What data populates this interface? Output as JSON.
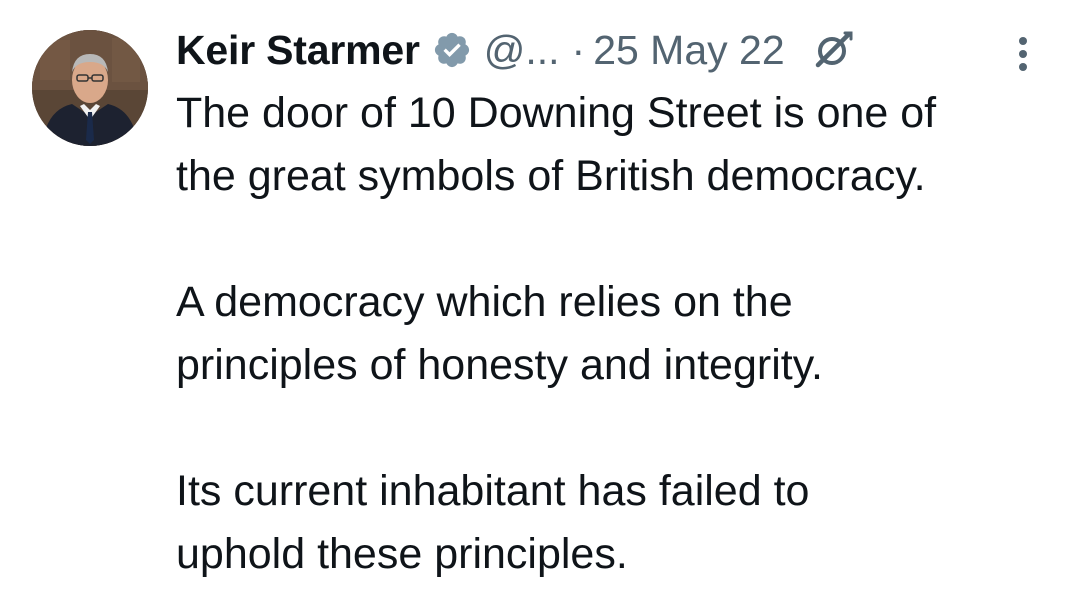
{
  "author": {
    "display_name": "Keir Starmer",
    "handle": "@...",
    "separator": "·",
    "date": "25 May 22",
    "verified_icon": "verified-badge-icon",
    "grok_icon": "grok-icon",
    "more_icon": "more-options-icon"
  },
  "tweet": {
    "paragraphs": [
      {
        "lines": [
          "The door of 10 Downing Street is one of",
          "the great symbols of British democracy."
        ]
      },
      {
        "lines": [
          "A democracy which relies on the",
          "principles of honesty and integrity."
        ]
      },
      {
        "lines": [
          "Its current inhabitant has failed to",
          "uphold these principles."
        ]
      }
    ]
  },
  "colors": {
    "text": "#0f1419",
    "secondary": "#536471",
    "verified": "#829aab",
    "background": "#ffffff"
  }
}
